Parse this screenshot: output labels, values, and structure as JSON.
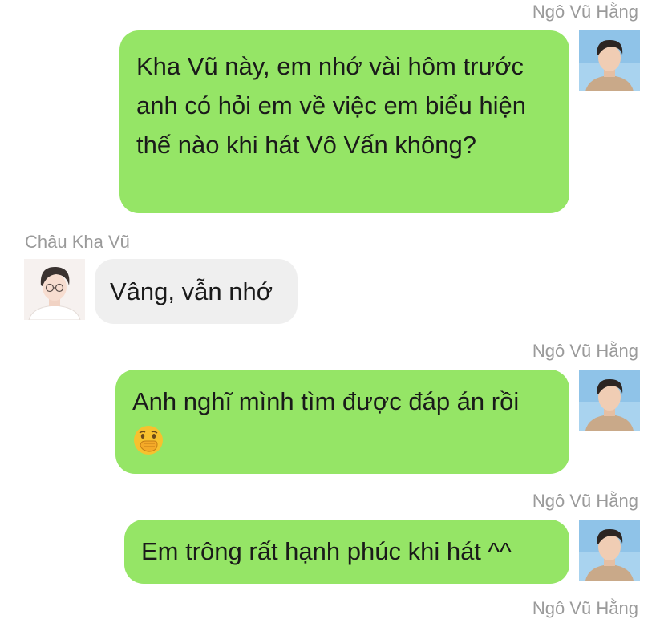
{
  "messages": [
    {
      "sender": "Ngô Vũ Hằng",
      "text": "Kha Vũ này, em nhớ vài hôm trước anh có hỏi em về việc em biểu hiện thế nào khi hát Vô Vấn không?"
    },
    {
      "sender": "Châu Kha Vũ",
      "text": "Vâng, vẫn nhớ"
    },
    {
      "sender": "Ngô Vũ Hằng",
      "text": "Anh nghĩ mình tìm được đáp án rồi",
      "emoji": "face-with-hand-over-mouth"
    },
    {
      "sender": "Ngô Vũ Hằng",
      "text": "Em trông rất hạnh phúc khi hát ^^"
    },
    {
      "sender": "Ngô Vũ Hằng"
    }
  ],
  "colors": {
    "sent_bubble": "#95e566",
    "received_bubble": "#efefef",
    "sender_name": "#9a9a9a",
    "text": "#1a1a1a"
  },
  "icons": {
    "sent_avatar": "avatar-photo-sky-background",
    "received_avatar": "avatar-photo-white-background"
  }
}
